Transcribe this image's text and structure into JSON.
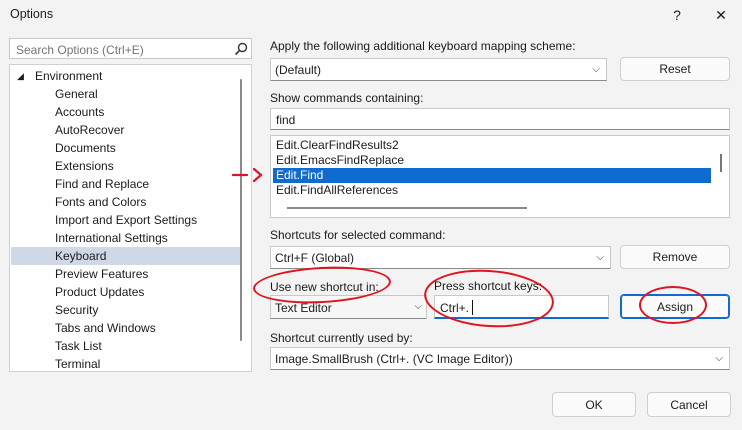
{
  "window": {
    "title": "Options",
    "help": "?",
    "close": "✕"
  },
  "search": {
    "placeholder": "Search Options (Ctrl+E)"
  },
  "tree": {
    "root": "Environment",
    "items": [
      "General",
      "Accounts",
      "AutoRecover",
      "Documents",
      "Extensions",
      "Find and Replace",
      "Fonts and Colors",
      "Import and Export Settings",
      "International Settings",
      "Keyboard",
      "Preview Features",
      "Product Updates",
      "Security",
      "Tabs and Windows",
      "Task List",
      "Terminal"
    ],
    "selected": "Keyboard"
  },
  "mapping": {
    "label": "Apply the following additional keyboard mapping scheme:",
    "value": "(Default)",
    "reset": "Reset"
  },
  "commands": {
    "label": "Show commands containing:",
    "filter": "find",
    "items": [
      "Edit.ClearFindResults2",
      "Edit.EmacsFindReplace",
      "Edit.Find",
      "Edit.FindAllReferences"
    ],
    "selected": "Edit.Find"
  },
  "shortcuts": {
    "label": "Shortcuts for selected command:",
    "value": "Ctrl+F (Global)",
    "remove": "Remove"
  },
  "new_shortcut": {
    "label": "Use new shortcut in:",
    "value": "Text Editor"
  },
  "press_keys": {
    "label": "Press shortcut keys:",
    "value": "Ctrl+."
  },
  "assign": "Assign",
  "used_by": {
    "label": "Shortcut currently used by:",
    "value": "Image.SmallBrush (Ctrl+. (VC Image Editor))"
  },
  "footer": {
    "ok": "OK",
    "cancel": "Cancel"
  },
  "colors": {
    "accent": "#0f6cce",
    "annotation": "#e0141e",
    "tree_selection": "#cfd8e6"
  }
}
